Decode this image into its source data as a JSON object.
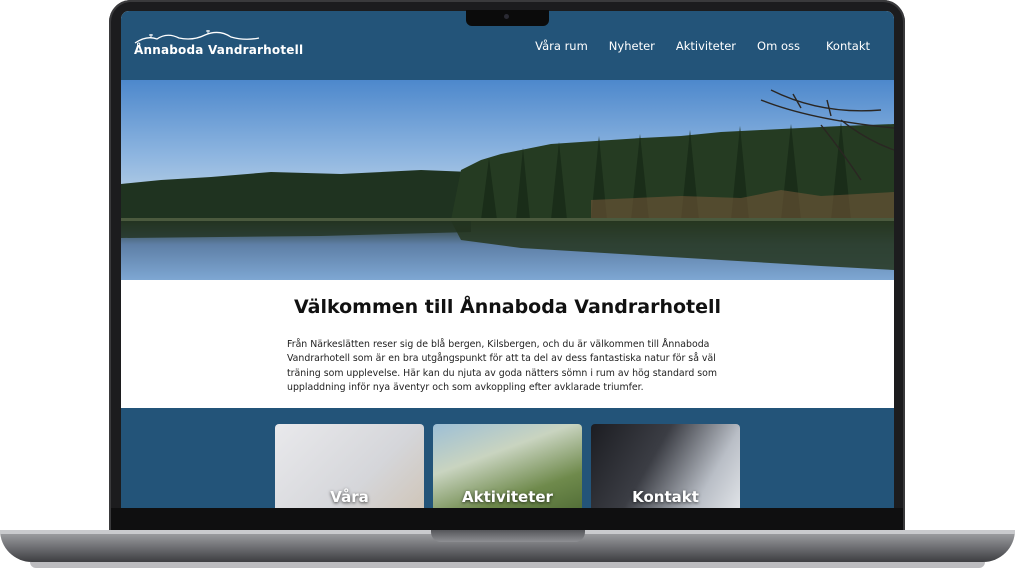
{
  "site": {
    "logo_text": "Ånnaboda Vandrarhotell",
    "nav": [
      "Våra rum",
      "Nyheter",
      "Aktiviteter",
      "Om oss",
      "Kontakt"
    ],
    "brand_color": "#235479"
  },
  "welcome": {
    "title": "Välkommen till Ånnaboda Vandrarhotell",
    "text": "Från Närkeslätten reser sig de blå bergen, Kilsbergen, och du är välkommen till Ånnaboda Vandrarhotell som är en bra utgångspunkt för att ta del av dess fantastiska natur för så väl träning som upplevelse. Här kan du njuta av goda nätters sömn i rum av hög standard som uppladdning inför nya äventyr och som avkoppling efter avklarade triumfer."
  },
  "cards": [
    {
      "label": "Våra"
    },
    {
      "label": "Aktiviteter"
    },
    {
      "label": "Kontakt"
    }
  ]
}
